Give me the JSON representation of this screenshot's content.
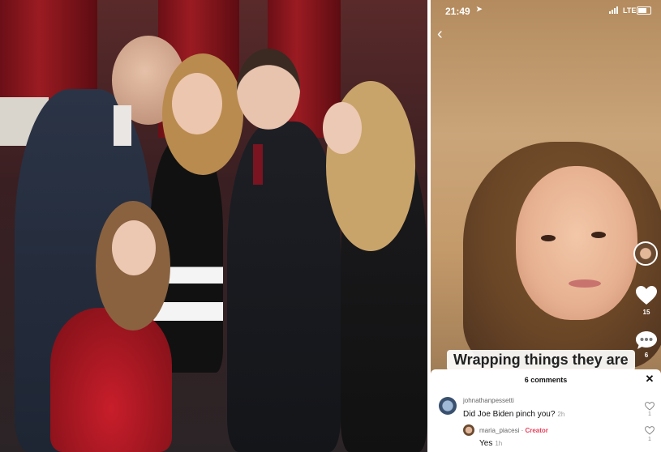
{
  "status_bar": {
    "time": "21:49",
    "network": "LTE",
    "location_icon": "location-arrow-icon",
    "battery_icon": "battery-icon"
  },
  "video": {
    "caption": "Wrapping things they are",
    "like_count": "15",
    "comment_count": "6"
  },
  "comments_panel": {
    "title": "6 comments",
    "comments": [
      {
        "username": "johnathanpessetti",
        "text": "Did Joe Biden pinch you?",
        "time": "2h",
        "likes": "1",
        "creator": ""
      },
      {
        "username": "maria_piacesi",
        "text": "Yes",
        "time": "1h",
        "likes": "1",
        "creator": "Creator"
      }
    ]
  },
  "colors": {
    "accent": "#e8405a",
    "sheet_background": "#ffffff"
  }
}
